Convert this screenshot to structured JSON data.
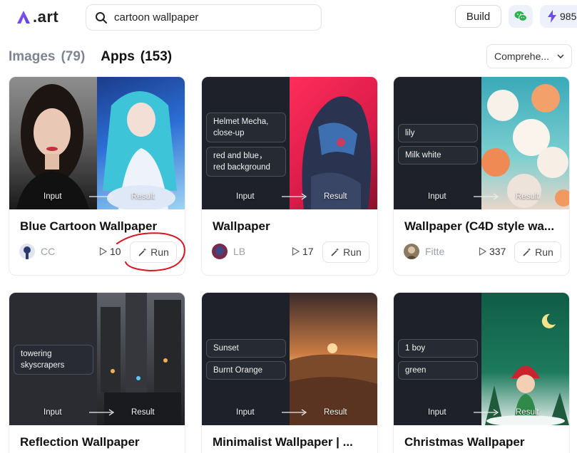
{
  "header": {
    "logo_text": ".art",
    "search_value": "cartoon wallpaper",
    "build_label": "Build",
    "credits": "985"
  },
  "tabs": [
    {
      "label": "Images",
      "count": "(79)",
      "active": false
    },
    {
      "label": "Apps",
      "count": "(153)",
      "active": true
    }
  ],
  "sort": {
    "selected": "Comprehe..."
  },
  "common": {
    "input_label": "Input",
    "result_label": "Result",
    "run_label": "Run"
  },
  "cards": [
    {
      "title": "Blue Cartoon Wallpaper",
      "author": "CC",
      "runs": "10",
      "chips": []
    },
    {
      "title": "Wallpaper",
      "author": "LB",
      "runs": "17",
      "chips": [
        "Helmet Mecha, close-up",
        "red and blue，red background"
      ]
    },
    {
      "title": "Wallpaper (C4D style wa...",
      "author": "Fitte",
      "runs": "337",
      "chips": [
        "lily",
        "Milk white"
      ]
    },
    {
      "title": "Reflection Wallpaper",
      "author": "",
      "runs": "",
      "chips": [
        "towering skyscrapers"
      ]
    },
    {
      "title": "Minimalist Wallpaper | ...",
      "author": "",
      "runs": "",
      "chips": [
        "Sunset",
        "Burnt Orange"
      ]
    },
    {
      "title": "Christmas Wallpaper",
      "author": "",
      "runs": "",
      "chips": [
        "1 boy",
        "green"
      ]
    }
  ],
  "colors": {
    "accent": "#6b4df0",
    "annotation": "#d9141e"
  }
}
